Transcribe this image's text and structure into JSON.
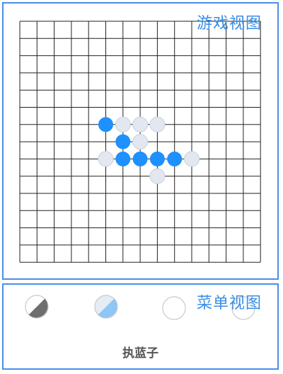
{
  "game_view": {
    "label": "游戏视图",
    "grid_size": 15,
    "board": {
      "blue_stones": [
        [
          6,
          5
        ],
        [
          7,
          6
        ],
        [
          8,
          6
        ],
        [
          8,
          7
        ],
        [
          8,
          8
        ],
        [
          8,
          9
        ]
      ],
      "white_stones": [
        [
          6,
          6
        ],
        [
          6,
          7
        ],
        [
          6,
          8
        ],
        [
          7,
          7
        ],
        [
          8,
          5
        ],
        [
          8,
          10
        ],
        [
          9,
          8
        ]
      ]
    },
    "colors": {
      "blue": "#1e90ff",
      "white": "#e3e8f0",
      "grid": "#222222"
    }
  },
  "menu_view": {
    "label": "菜单视图",
    "status": "执蓝子",
    "buttons": [
      {
        "name": "dark-piece-option",
        "style": "dark-half"
      },
      {
        "name": "blue-piece-option",
        "style": "blue-half"
      },
      {
        "name": "white-piece-option",
        "style": "empty"
      },
      {
        "name": "extra-piece-option",
        "style": "empty"
      }
    ]
  }
}
